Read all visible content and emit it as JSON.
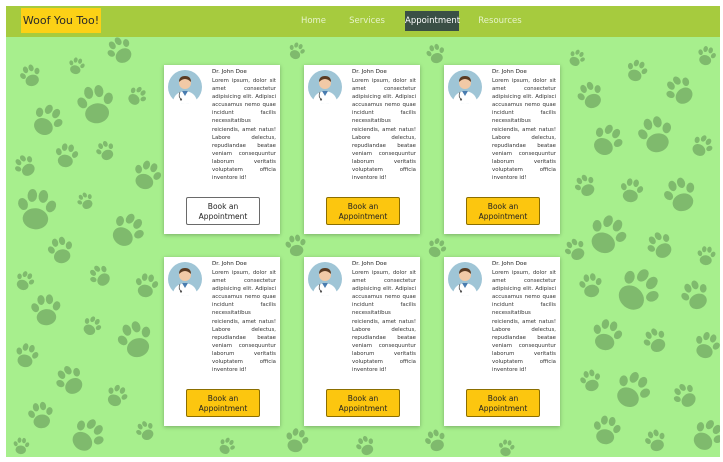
{
  "brand": "Woof You Too!",
  "nav": [
    {
      "label": "Home",
      "active": false
    },
    {
      "label": "Services",
      "active": false
    },
    {
      "label": "Appointment",
      "active": true
    },
    {
      "label": "Resources",
      "active": false
    }
  ],
  "colors": {
    "navbar": "#a6cb3e",
    "brand_bg": "#fcd116",
    "page_bg": "#a7ef8d",
    "paw": "#5f8f55",
    "button": "#fcc60f"
  },
  "cards": [
    {
      "name": "Dr. John Doe",
      "bio": "Lorem ipsum, dolor sit amet consectetur adipisicing elit. Adipisci accusamus nemo quae incidunt facilis necessitatibus reiciendis, amet natus! Labore delectus, repudiandae beatae veniam consequuntur laborum veritatis voluptatem officia inventore id!",
      "button": "Book an Appointment",
      "button_style": "outline"
    },
    {
      "name": "Dr. John Doe",
      "bio": "Lorem ipsum, dolor sit amet consectetur adipisicing elit. Adipisci accusamus nemo quae incidunt facilis necessitatibus reiciendis, amet natus! Labore delectus, repudiandae beatae veniam consequuntur laborum veritatis voluptatem officia inventore id!",
      "button": "Book an Appointment",
      "button_style": "filled"
    },
    {
      "name": "Dr. John Doe",
      "bio": "Lorem ipsum, dolor sit amet consectetur adipisicing elit. Adipisci accusamus nemo quae incidunt facilis necessitatibus reiciendis, amet natus! Labore delectus, repudiandae beatae veniam consequuntur laborum veritatis voluptatem officia inventore id!",
      "button": "Book an Appointment",
      "button_style": "filled"
    },
    {
      "name": "Dr. John Doe",
      "bio": "Lorem ipsum, dolor sit amet consectetur adipisicing elit. Adipisci accusamus nemo quae incidunt facilis necessitatibus reiciendis, amet natus! Labore delectus, repudiandae beatae veniam consequuntur laborum veritatis voluptatem officia inventore id!",
      "button": "Book an Appointment",
      "button_style": "filled"
    },
    {
      "name": "Dr. John Doe",
      "bio": "Lorem ipsum, dolor sit amet consectetur adipisicing elit. Adipisci accusamus nemo quae incidunt facilis necessitatibus reiciendis, amet natus! Labore delectus, repudiandae beatae veniam consequuntur laborum veritatis voluptatem officia inventore id!",
      "button": "Book an Appointment",
      "button_style": "filled"
    },
    {
      "name": "Dr. John Doe",
      "bio": "Lorem ipsum, dolor sit amet consectetur adipisicing elit. Adipisci accusamus nemo quae incidunt facilis necessitatibus reiciendis, amet natus! Labore delectus, repudiandae beatae veniam consequuntur laborum veritatis voluptatem officia inventore id!",
      "button": "Book an Appointment",
      "button_style": "filled"
    }
  ]
}
